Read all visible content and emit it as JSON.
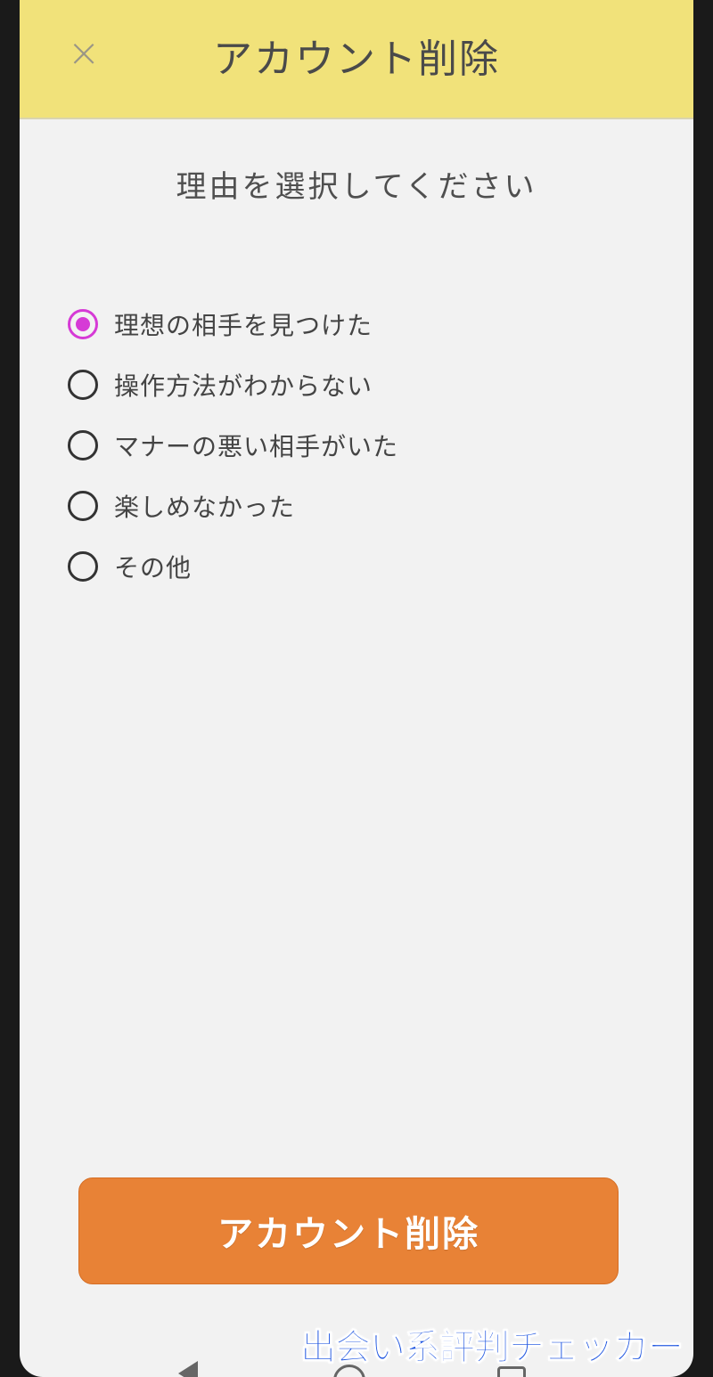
{
  "header": {
    "close_icon": "×",
    "title": "アカウント削除"
  },
  "prompt": "理由を選択してください",
  "reasons": [
    {
      "label": "理想の相手を見つけた",
      "selected": true
    },
    {
      "label": "操作方法がわからない",
      "selected": false
    },
    {
      "label": "マナーの悪い相手がいた",
      "selected": false
    },
    {
      "label": "楽しめなかった",
      "selected": false
    },
    {
      "label": "その他",
      "selected": false
    }
  ],
  "delete_button": {
    "label": "アカウント削除"
  },
  "watermark": "出会い系評判チェッカー",
  "colors": {
    "header_bg": "#f1e27a",
    "button_bg": "#e88236",
    "radio_selected": "#d63ad6"
  }
}
